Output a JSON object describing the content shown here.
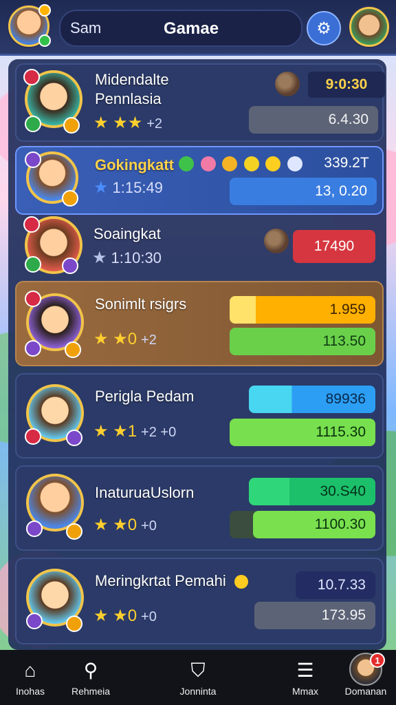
{
  "search": {
    "value": "Sam",
    "title": "Gamae"
  },
  "rows": [
    {
      "name_line1": "Midendalte",
      "name_line2": "Pennlasia",
      "stars": "★ ★★",
      "meta": "+2",
      "top_value": "9:0:30",
      "bar_value": "6.4.30"
    },
    {
      "name": "Gokingkatt",
      "timer": "1:15:49",
      "top_value": "339.2T",
      "bar_value": "13, 0.20"
    },
    {
      "name": "Soaingkat",
      "timer": "1:10:30",
      "bar_value": "17490"
    },
    {
      "name": "Sonimlt rsigrs",
      "stars": "★ ★0",
      "meta": "+2",
      "bar1_value": "1.959",
      "bar2_value": "113.50"
    },
    {
      "name": "Perigla Pedam",
      "stars": "★ ★1",
      "meta": "+2   +0",
      "bar1_value": "89936",
      "bar2_value": "1115.30"
    },
    {
      "name": "InaturuaUslorn",
      "stars": "★ ★0",
      "meta": "+0",
      "bar1_value": "30.S40",
      "bar2_value": "1100.30"
    },
    {
      "name": "Meringkrtat Pemahi",
      "stars": "★ ★0",
      "meta": "+0",
      "bar1_value": "10.7.33",
      "bar2_value": "173.95"
    }
  ],
  "nav": [
    {
      "label": "Inohas",
      "icon": "home-icon"
    },
    {
      "label": "Rehmeia",
      "icon": "search-icon"
    },
    {
      "label": "Jonninta",
      "icon": "shield-icon"
    },
    {
      "label": "Mmax",
      "icon": "chat-icon"
    },
    {
      "label": "Domanan",
      "icon": "profile-avatar",
      "badge": "1"
    }
  ],
  "colors": {
    "accent": "#f2c449",
    "primary_blue": "#3b6fd6",
    "danger": "#d6363f",
    "success": "#6ad04a"
  }
}
